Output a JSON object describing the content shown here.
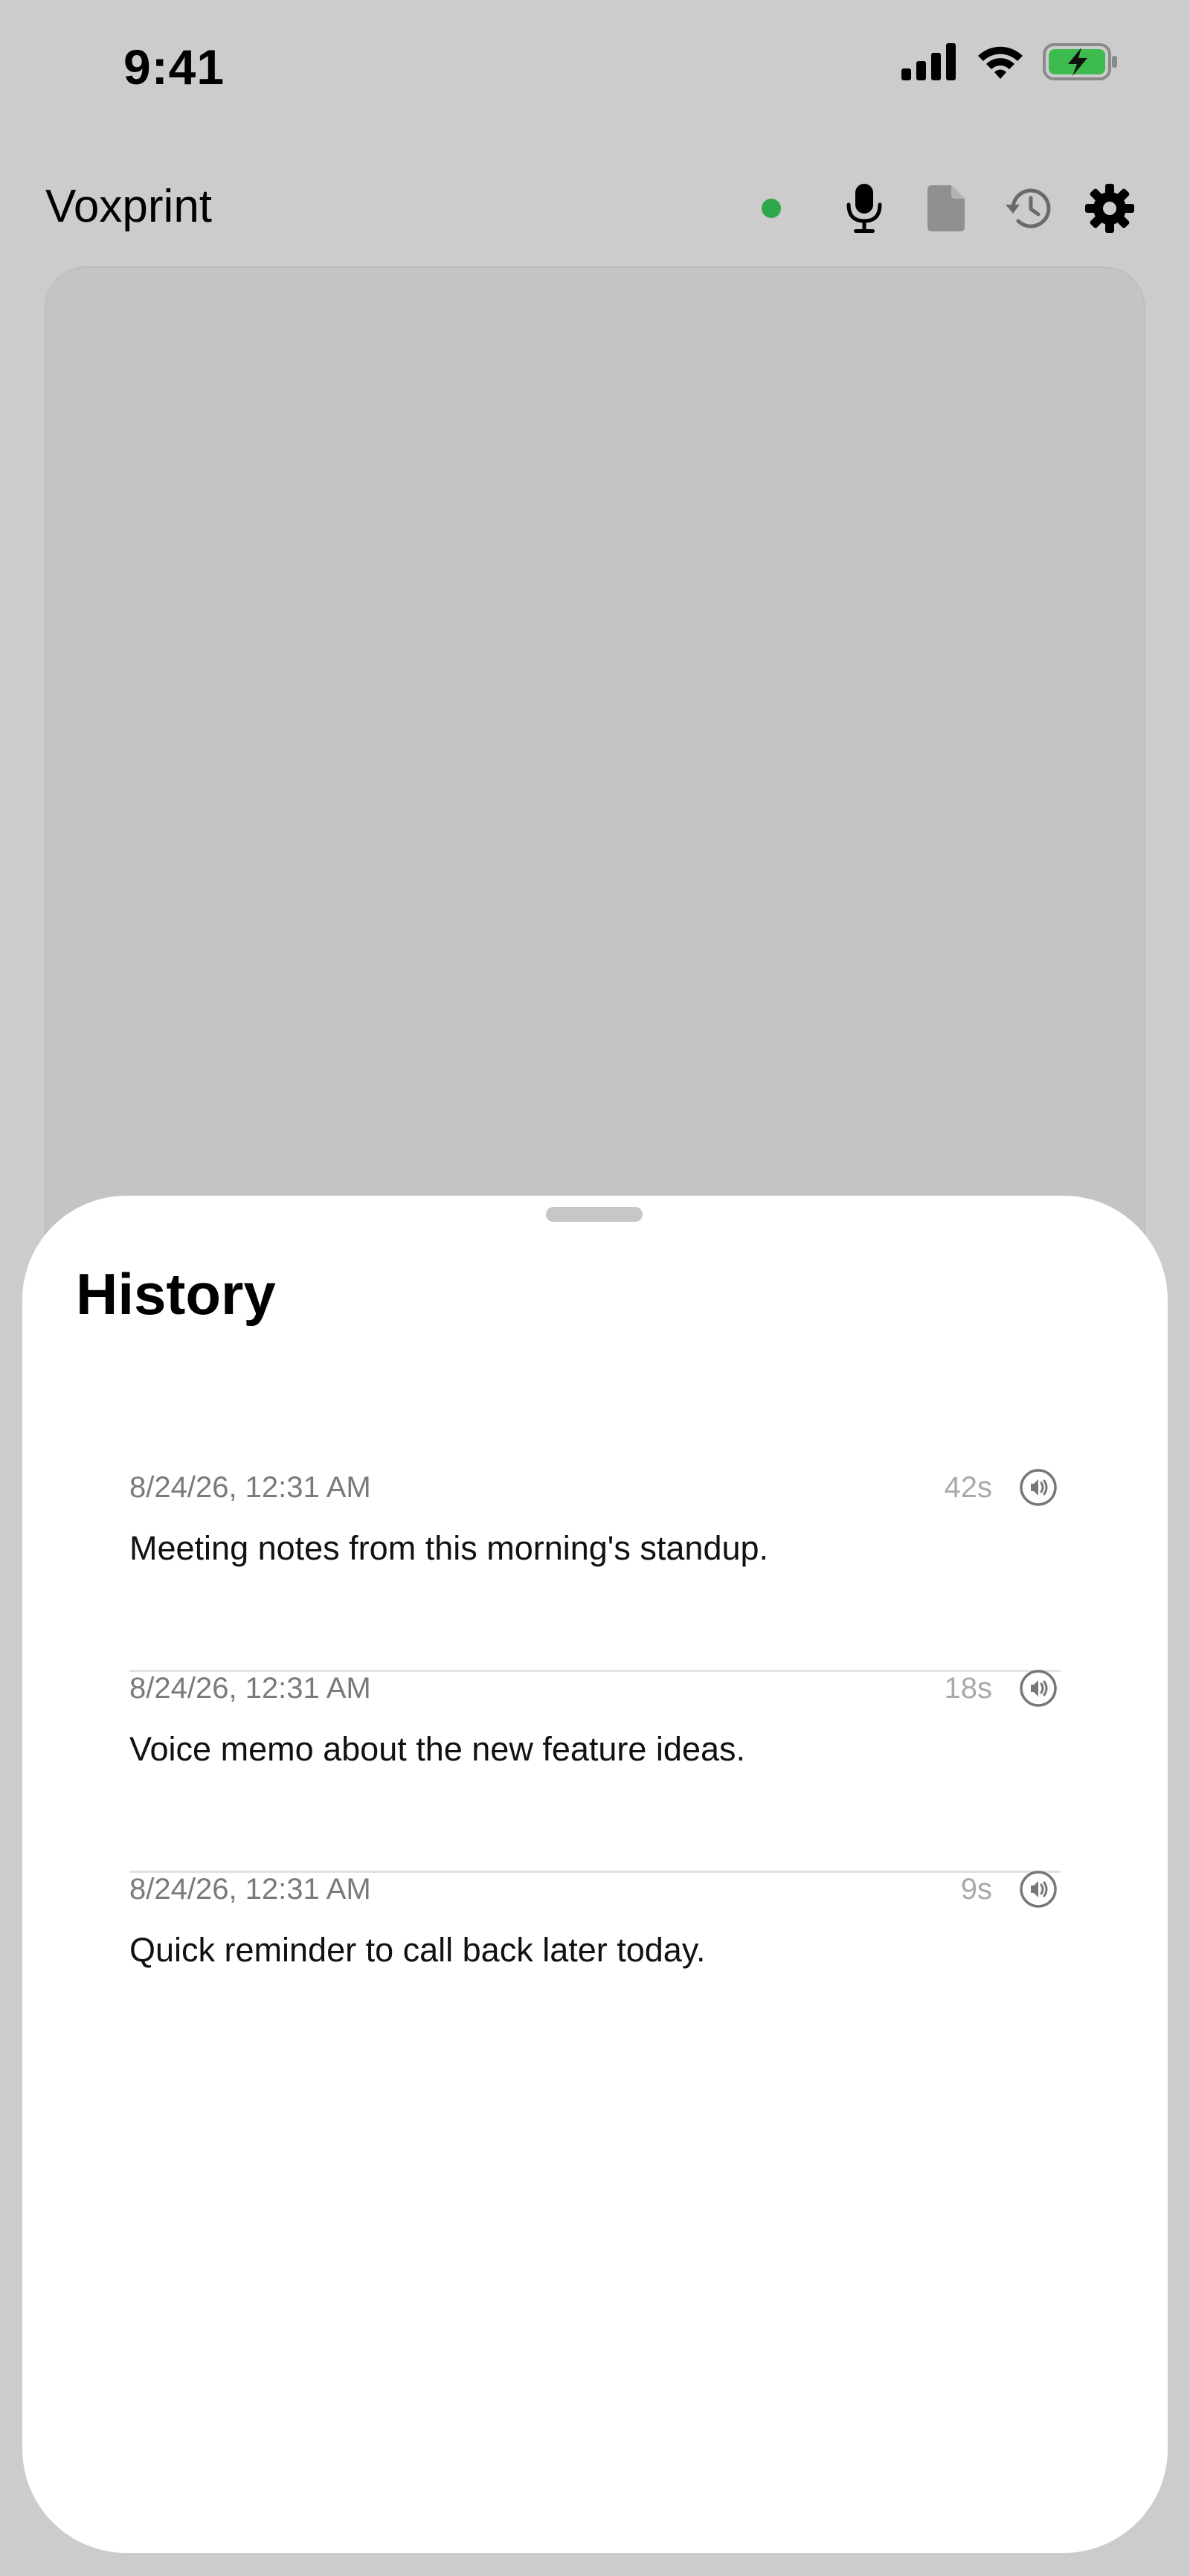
{
  "status_bar": {
    "time": "9:41"
  },
  "app": {
    "title": "Voxprint",
    "status_color": "#2ea84a"
  },
  "header_icons": [
    "microphone-icon",
    "document-icon",
    "history-icon",
    "gear-icon"
  ],
  "history_sheet": {
    "title": "History",
    "items": [
      {
        "date": "8/24/26, 12:31 AM",
        "text": "Meeting notes from this morning's standup.",
        "duration": "42s"
      },
      {
        "date": "8/24/26, 12:31 AM",
        "text": "Voice memo about the new feature ideas.",
        "duration": "18s"
      },
      {
        "date": "8/24/26, 12:31 AM",
        "text": "Quick reminder to call back later today.",
        "duration": "9s"
      }
    ]
  }
}
